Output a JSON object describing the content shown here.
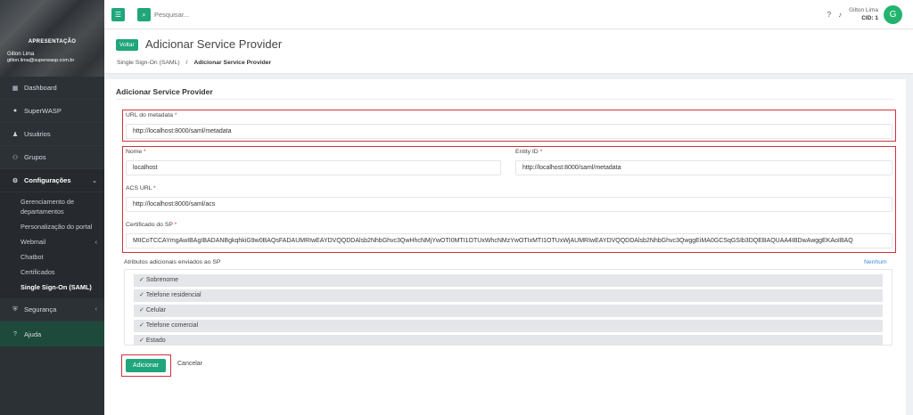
{
  "sidebar": {
    "org": "APRESENTAÇÃO",
    "user_name": "Gilton Lima",
    "user_email": "gilton.lima@superwasp.com.br",
    "items": [
      {
        "label": "Dashboard",
        "icon": "dashboard-icon"
      },
      {
        "label": "SuperWASP",
        "icon": "chat-icon"
      },
      {
        "label": "Usuários",
        "icon": "user-icon"
      },
      {
        "label": "Grupos",
        "icon": "group-icon"
      },
      {
        "label": "Configurações",
        "icon": "gear-icon"
      }
    ],
    "config_sub": [
      "Gerenciamento de departamentos",
      "Personalização do portal",
      "Webmail",
      "Chatbot",
      "Certificados",
      "Single Sign-On (SAML)"
    ],
    "security": "Segurança",
    "help": "Ajuda"
  },
  "topbar": {
    "search_placeholder": "Pesquisar...",
    "user_name": "Gilton Lima",
    "cid": "CID: 1",
    "avatar_letter": "G"
  },
  "header": {
    "back_label": "Voltar",
    "title": "Adicionar Service Provider",
    "breadcrumb_parent": "Single Sign-On (SAML)",
    "breadcrumb_sep": "/",
    "breadcrumb_current": "Adicionar Service Provider"
  },
  "form": {
    "card_title": "Adicionar Service Provider",
    "metadata_url_label": "URL do metadata",
    "metadata_url_value": "http://localhost:8000/saml/metadata",
    "name_label": "Nome",
    "name_value": "localhost",
    "entity_id_label": "Entity ID",
    "entity_id_value": "http://localhost:8000/saml/metadata",
    "acs_url_label": "ACS URL",
    "acs_url_value": "http://localhost:8000/saml/acs",
    "cert_label": "Certificado do SP",
    "cert_value": "MIICoTCCAYmgAwIBAgIBADANBgkqhkiG9w0BAQsFADAUMRIwEAYDVQQDDAlsb2NhbGhvc3QwHhcNMjYwOTI0MTI1OTUxWhcNMzYwOTIxMTI1OTUxWjAUMRIwEAYDVQQDDAlsb2NhbGhvc3QwggEiMA0GCSqGSIb3DQEBAQUAA4IBDwAwggEKAoIBAQ",
    "required_mark": "*",
    "attrs_label": "Atributos adicionais enviados ao SP",
    "attrs_none": "Nenhum",
    "attrs": [
      "Sobrenome",
      "Telefone residencial",
      "Celular",
      "Telefone comercial",
      "Estado"
    ],
    "check": "✓",
    "submit_label": "Adicionar",
    "cancel_label": "Cancelar"
  },
  "colors": {
    "accent": "#1fa67a",
    "highlight": "#d0323c",
    "sidebar": "#2c3136"
  }
}
